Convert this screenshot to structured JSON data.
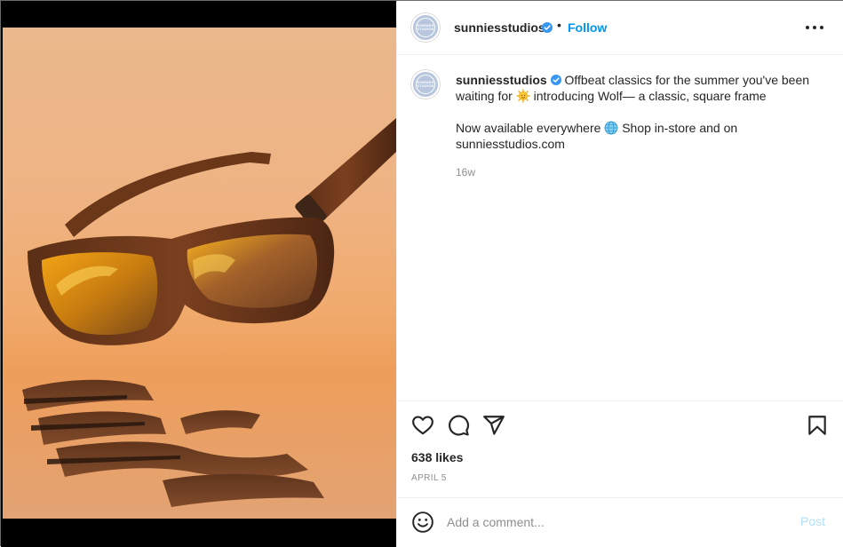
{
  "post": {
    "account": {
      "username": "sunniesstudios",
      "verified": true,
      "avatar_text": "SUNNIES STUDIOS",
      "avatar_color": "#b7c6dd"
    },
    "header": {
      "separator": "•",
      "follow_label": "Follow",
      "more_icon": "more-options-icon"
    },
    "caption": {
      "line1_before_emoji": "Offbeat classics for the summer you've been waiting for",
      "line1_emoji": "sun-emoji",
      "line1_after_emoji": "introducing Wolf— a classic, square frame",
      "line2_before_emoji": "Now available everywhere",
      "line2_emoji": "globe-emoji",
      "line2_after_emoji": "Shop in-store and on sunniesstudios.com",
      "time_ago": "16w"
    },
    "actions": {
      "like_icon": "heart-icon",
      "comment_icon": "comment-icon",
      "share_icon": "share-icon",
      "save_icon": "bookmark-icon"
    },
    "likes_label": "638 likes",
    "date_label": "APRIL 5",
    "comment": {
      "emoji_icon": "smiley-icon",
      "placeholder": "Add a comment...",
      "value": "",
      "post_label": "Post"
    },
    "colors": {
      "accent": "#0095f6",
      "post_disabled": "#b2dffc",
      "text": "#262626",
      "muted": "#8e8e8e"
    }
  }
}
